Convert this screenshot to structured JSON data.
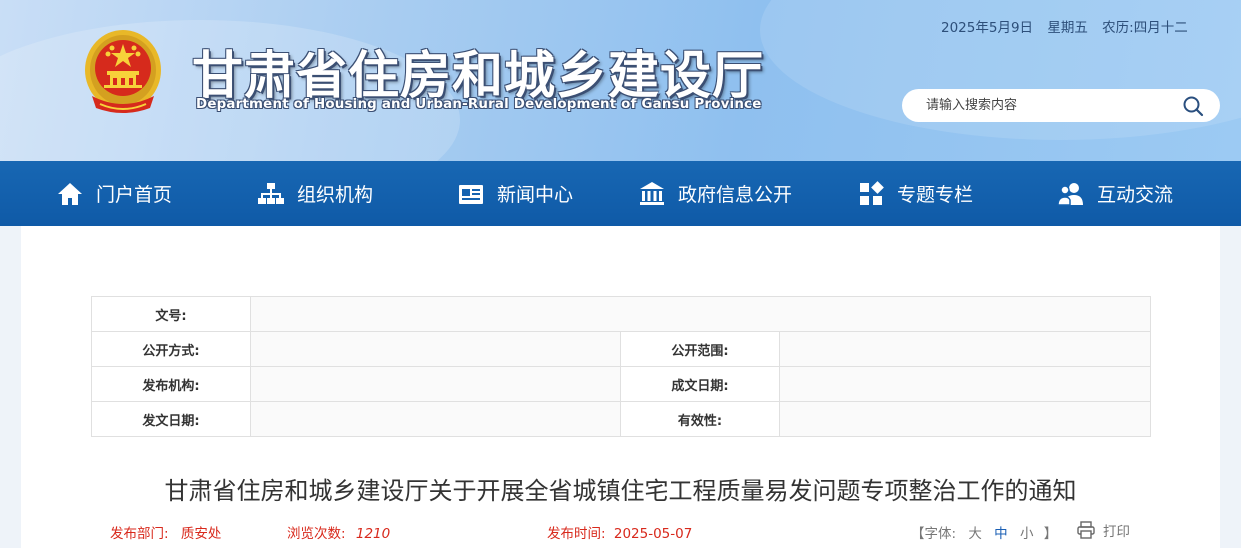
{
  "header": {
    "title": "甘肃省住房和城乡建设厅",
    "subtitle": "Department of Housing and Urban-Rural Development of Gansu Province",
    "date": "2025年5月9日",
    "weekday": "星期五",
    "lunar": "农历:四月十二",
    "search_placeholder": "请输入搜索内容"
  },
  "nav": {
    "items": [
      {
        "label": "门户首页",
        "icon": "home-icon"
      },
      {
        "label": "组织机构",
        "icon": "org-chart-icon"
      },
      {
        "label": "新闻中心",
        "icon": "news-icon"
      },
      {
        "label": "政府信息公开",
        "icon": "government-building-icon"
      },
      {
        "label": "专题专栏",
        "icon": "grid-icon"
      },
      {
        "label": "互动交流",
        "icon": "users-icon"
      }
    ]
  },
  "meta_table": {
    "doc_no_label": "文号:",
    "doc_no_value": "",
    "disclosure_method_label": "公开方式:",
    "disclosure_method_value": "",
    "disclosure_scope_label": "公开范围:",
    "disclosure_scope_value": "",
    "issuer_label": "发布机构:",
    "issuer_value": "",
    "created_date_label": "成文日期:",
    "created_date_value": "",
    "issue_date_label": "发文日期:",
    "issue_date_value": "",
    "validity_label": "有效性:",
    "validity_value": ""
  },
  "article": {
    "title": "甘肃省住房和城乡建设厅关于开展全省城镇住宅工程质量易发问题专项整治工作的通知",
    "dept_label": "发布部门:",
    "dept_value": "质安处",
    "views_label": "浏览次数:",
    "views_value": "1210",
    "pub_time_label": "发布时间:",
    "pub_time_value": "2025-05-07",
    "font_bracket_open": "【",
    "font_label": "字体:",
    "font_large": "大",
    "font_medium": "中",
    "font_small": "小",
    "font_bracket_close": "】",
    "print_label": "打印"
  },
  "colors": {
    "nav_bg": "#1462b0",
    "accent_red": "#d8291c",
    "title_text": "#333333"
  }
}
